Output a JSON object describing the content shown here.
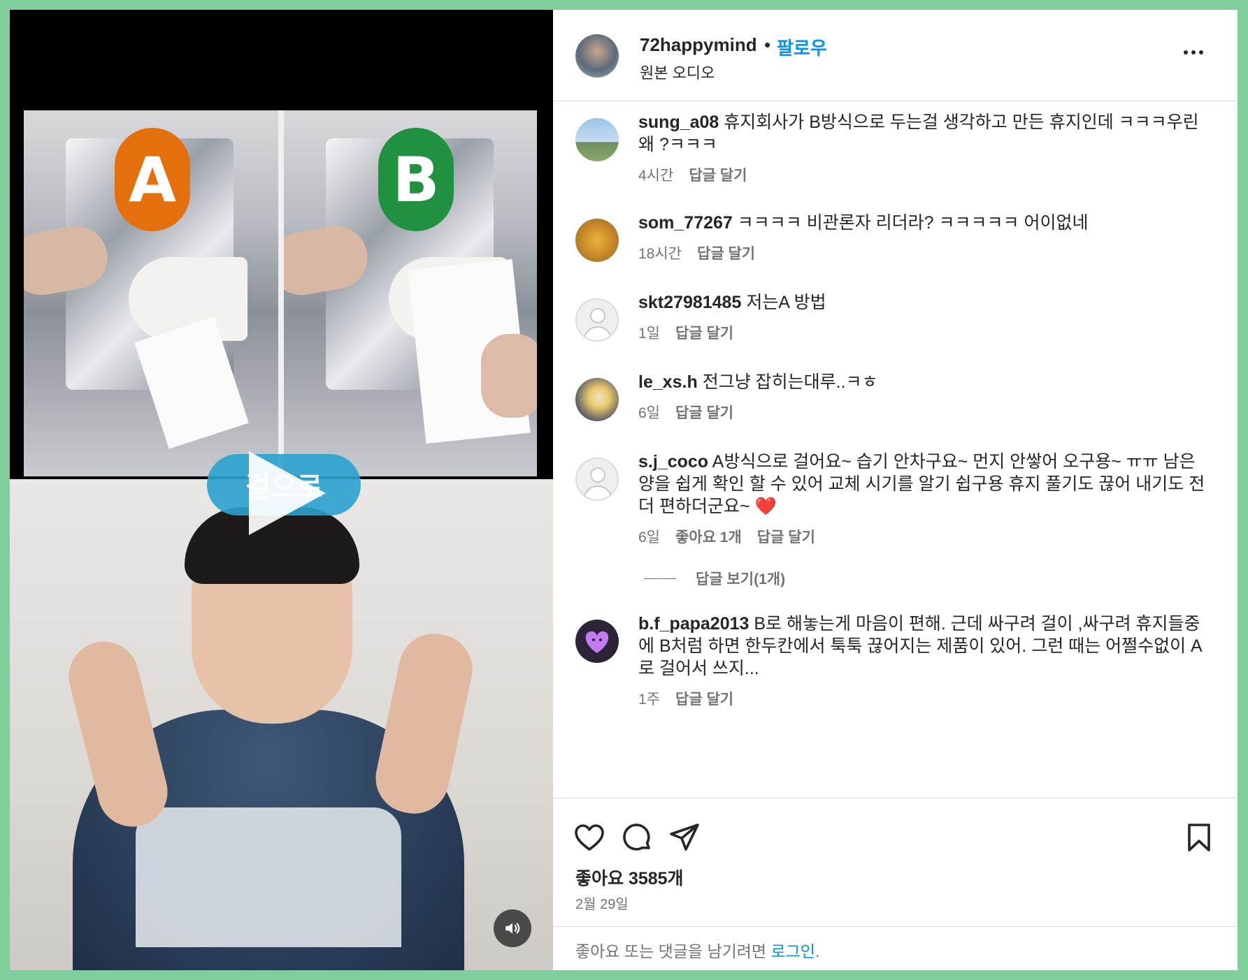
{
  "post": {
    "username": "72happymind",
    "separator": "•",
    "follow_label": "팔로우",
    "audio_label": "원본 오디오"
  },
  "video": {
    "badge_a": "A",
    "badge_b": "B",
    "caption": "걸으로"
  },
  "comments": [
    {
      "user": "sung_a08",
      "text": "휴지회사가 B방식으로 두는걸 생각하고 만든 휴지인데 ㅋㅋㅋ우린 왜 ?ㅋㅋㅋ",
      "time": "4시간",
      "likes": "",
      "reply": "답글 달기"
    },
    {
      "user": "som_77267",
      "text": "ㅋㅋㅋㅋ 비관론자 리더라? ㅋㅋㅋㅋㅋ 어이없네",
      "time": "18시간",
      "likes": "",
      "reply": "답글 달기"
    },
    {
      "user": "skt27981485",
      "text": "저는A 방법",
      "time": "1일",
      "likes": "",
      "reply": "답글 달기"
    },
    {
      "user": "le_xs.h",
      "text": "전그냥 잡히는대루..ㅋㅎ",
      "time": "6일",
      "likes": "",
      "reply": "답글 달기"
    },
    {
      "user": "s.j_coco",
      "text": "A방식으로 걸어요~ 습기 안차구요~ 먼지 안쌓어 오구용~ ㅠㅠ 남은 양을 쉽게 확인 할 수 있어 교체 시기를 알기 쉽구용 휴지 풀기도 끊어 내기도 전 더 편하더군요~ ❤️",
      "time": "6일",
      "likes": "좋아요 1개",
      "reply": "답글 달기",
      "view_replies": "답글 보기(1개)"
    },
    {
      "user": "b.f_papa2013",
      "text": "B로 해놓는게 마음이 편해. 근데 싸구려 걸이 ,싸구려 휴지들중에 B처럼 하면 한두칸에서 툭툭 끊어지는 제품이 있어. 그런 때는 어쩔수없이 A로 걸어서 쓰지...",
      "time": "1주",
      "likes": "",
      "reply": "답글 달기"
    }
  ],
  "actions": {
    "likes": "좋아요 3585개",
    "date": "2월 29일"
  },
  "footer": {
    "prompt": "좋아요 또는 댓글을 남기려면 ",
    "login": "로그인",
    "period": "."
  },
  "colors": {
    "accent": "#0095f6",
    "badge_a": "#e3700d",
    "badge_b": "#1f9140",
    "frame_border": "#7fcf9a"
  }
}
